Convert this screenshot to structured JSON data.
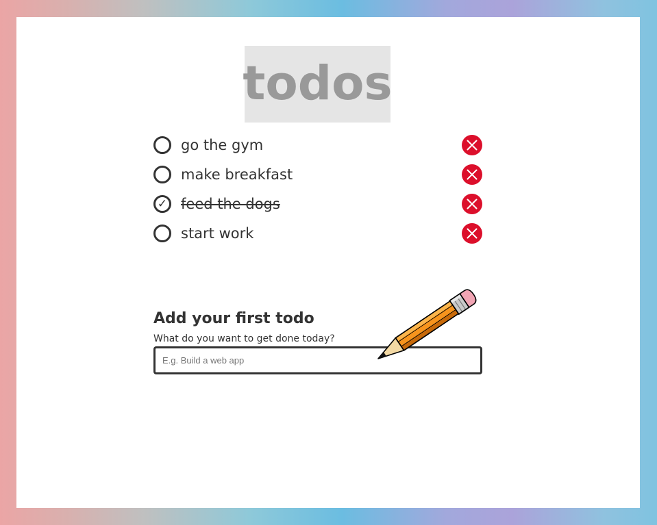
{
  "app": {
    "title": "todos"
  },
  "todos": [
    {
      "label": "go the gym",
      "completed": false,
      "check_icon": "empty-circle-icon",
      "delete_icon": "close-x-icon"
    },
    {
      "label": "make breakfast",
      "completed": false,
      "check_icon": "empty-circle-icon",
      "delete_icon": "close-x-icon"
    },
    {
      "label": "feed the dogs",
      "completed": true,
      "check_glyph": "✓",
      "check_icon": "checkmark-circle-icon",
      "delete_icon": "close-x-icon"
    },
    {
      "label": "start work",
      "completed": false,
      "check_icon": "empty-circle-icon",
      "delete_icon": "close-x-icon"
    }
  ],
  "add_todo": {
    "heading": "Add your first todo",
    "subheading": "What do you want to get done today?",
    "input_value": "",
    "input_placeholder": "E.g. Build a web app",
    "decoration_icon": "pencil-icon"
  },
  "colors": {
    "delete_red": "#dc0f2b",
    "text": "#333333",
    "title_text": "#999999",
    "title_bg": "#e5e5e5",
    "panel_bg": "#ffffff"
  }
}
